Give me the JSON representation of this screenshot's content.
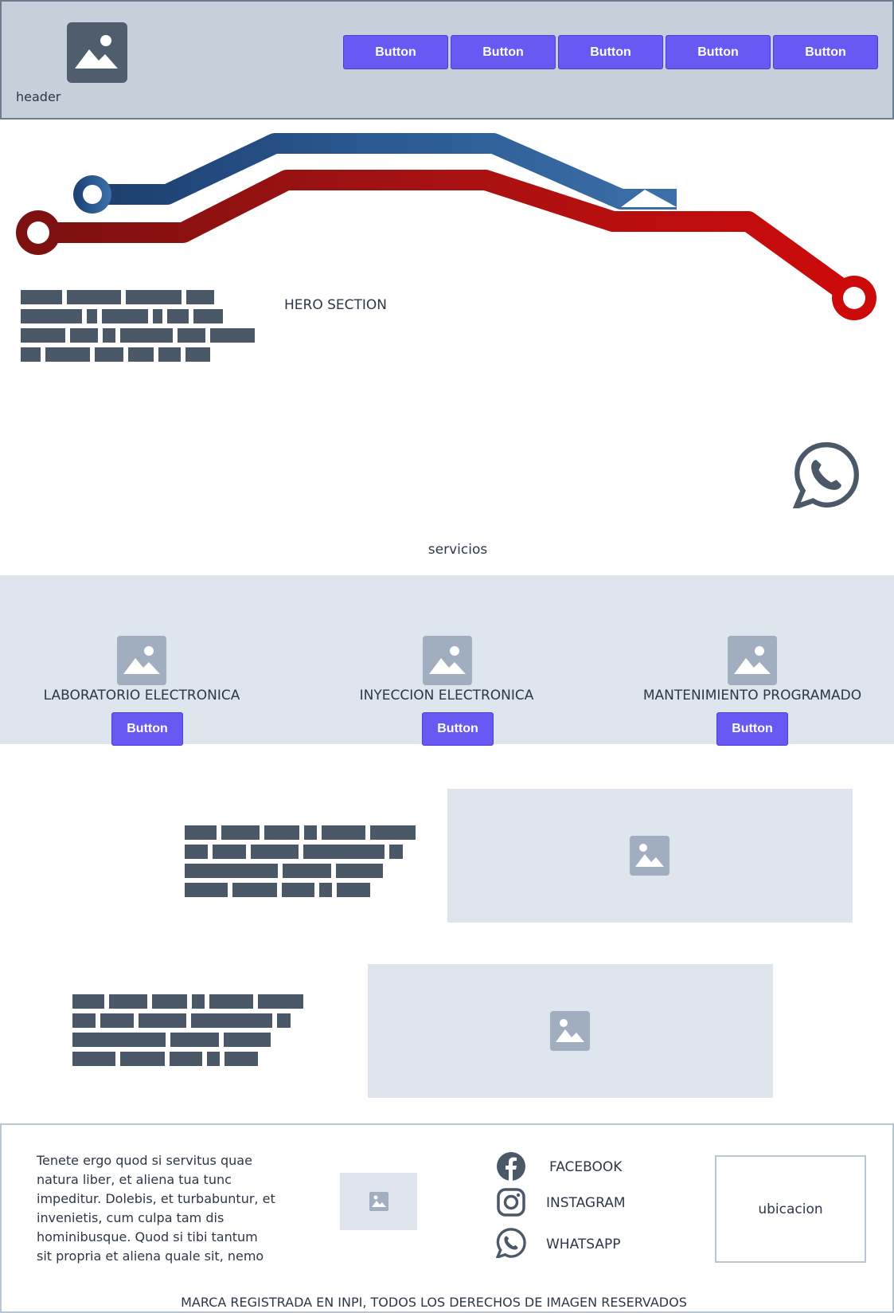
{
  "header": {
    "label": "header",
    "nav": [
      "Button",
      "Button",
      "Button",
      "Button",
      "Button"
    ]
  },
  "hero": {
    "title": "HERO SECTION",
    "circuit_colors": {
      "blue": "#2b5a92",
      "red": "#c41010"
    }
  },
  "servicios": {
    "title": "servicios",
    "items": [
      {
        "title": "LABORATORIO ELECTRONICA",
        "button": "Button"
      },
      {
        "title": "INYECCION ELECTRONICA",
        "button": "Button"
      },
      {
        "title": "MANTENIMIENTO PROGRAMADO",
        "button": "Button"
      }
    ]
  },
  "footer": {
    "text": "Tenete ergo quod si servitus quae natura liber, et aliena tua tunc impeditur. Dolebis, et turbabuntur, et invenietis, cum culpa tam dis hominibusque. Quod si tibi tantum sit propria et aliena quale sit, nemo",
    "social": [
      {
        "label": "FACEBOOK",
        "icon": "facebook-icon"
      },
      {
        "label": "INSTAGRAM",
        "icon": "instagram-icon"
      },
      {
        "label": "WHATSAPP",
        "icon": "whatsapp-icon"
      }
    ],
    "location": "ubicacion",
    "copyright": "MARCA REGISTRADA EN INPI, TODOS LOS DERECHOS DE IMAGEN RESERVADOS"
  },
  "colors": {
    "accent": "#6759f1",
    "header_bg": "#c5d0da",
    "section_bg": "#dfe5ed",
    "placeholder_text": "#4a5868"
  }
}
